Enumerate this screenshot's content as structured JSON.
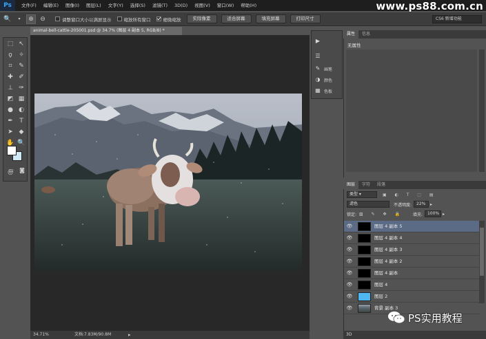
{
  "app": {
    "logo": "Ps"
  },
  "menu": [
    "文件(F)",
    "编辑(E)",
    "图像(I)",
    "图层(L)",
    "文字(Y)",
    "选择(S)",
    "滤镜(T)",
    "3D(D)",
    "视图(V)",
    "窗口(W)",
    "帮助(H)"
  ],
  "watermark_site": "www.ps88.com.cn",
  "options": {
    "checks": [
      {
        "label": "调整窗口大小以满屏显示",
        "checked": false
      },
      {
        "label": "缩放所有窗口",
        "checked": false
      },
      {
        "label": "细微缩放",
        "checked": true
      }
    ],
    "buttons": [
      "实际像素",
      "适合屏幕",
      "填充屏幕",
      "打印尺寸"
    ],
    "workspace": "CS6 新增功能"
  },
  "document": {
    "tab_title": "animal-bell-cattle-205001.psd @ 34.7% (图层 4 副本 5, RGB/8) *",
    "zoom": "34.71%",
    "doc_size": "文档:7.83M/90.8M"
  },
  "mini_panel": [
    {
      "icon": "play-icon",
      "label": ""
    },
    {
      "icon": "adjust-icon",
      "label": ""
    },
    {
      "icon": "brush-preset-icon",
      "label": "画笔"
    },
    {
      "icon": "color-icon",
      "label": "颜色"
    },
    {
      "icon": "swatches-icon",
      "label": "色板"
    }
  ],
  "properties": {
    "tabs": [
      "属性",
      "信息"
    ],
    "empty_text": "无属性"
  },
  "layers": {
    "tabs": [
      "图层",
      "字符",
      "段落"
    ],
    "filter_label": "类型",
    "blend_mode": "滤色",
    "opacity_label": "不透明度:",
    "opacity_value": "22%",
    "lock_label": "锁定:",
    "fill_label": "填充:",
    "fill_value": "100%",
    "items": [
      {
        "name": "图层 4 副本 5",
        "selected": true,
        "thumb": "black"
      },
      {
        "name": "图层 4 副本 4",
        "selected": false,
        "thumb": "black"
      },
      {
        "name": "图层 4 副本 3",
        "selected": false,
        "thumb": "black"
      },
      {
        "name": "图层 4 副本 2",
        "selected": false,
        "thumb": "black"
      },
      {
        "name": "图层 4 副本",
        "selected": false,
        "thumb": "black"
      },
      {
        "name": "图层 4",
        "selected": false,
        "thumb": "black"
      },
      {
        "name": "图层 2",
        "selected": false,
        "thumb": "blue"
      },
      {
        "name": "背景 副本 3",
        "selected": false,
        "thumb": "photo"
      }
    ]
  },
  "watermark_wechat": "PS实用教程",
  "panel_3d": "3D",
  "colors": {
    "fg": "#ffffff",
    "bg": "#cfeaf5",
    "selected_layer": "#5b6b86",
    "blue_thumb": "#4fb6f0"
  }
}
